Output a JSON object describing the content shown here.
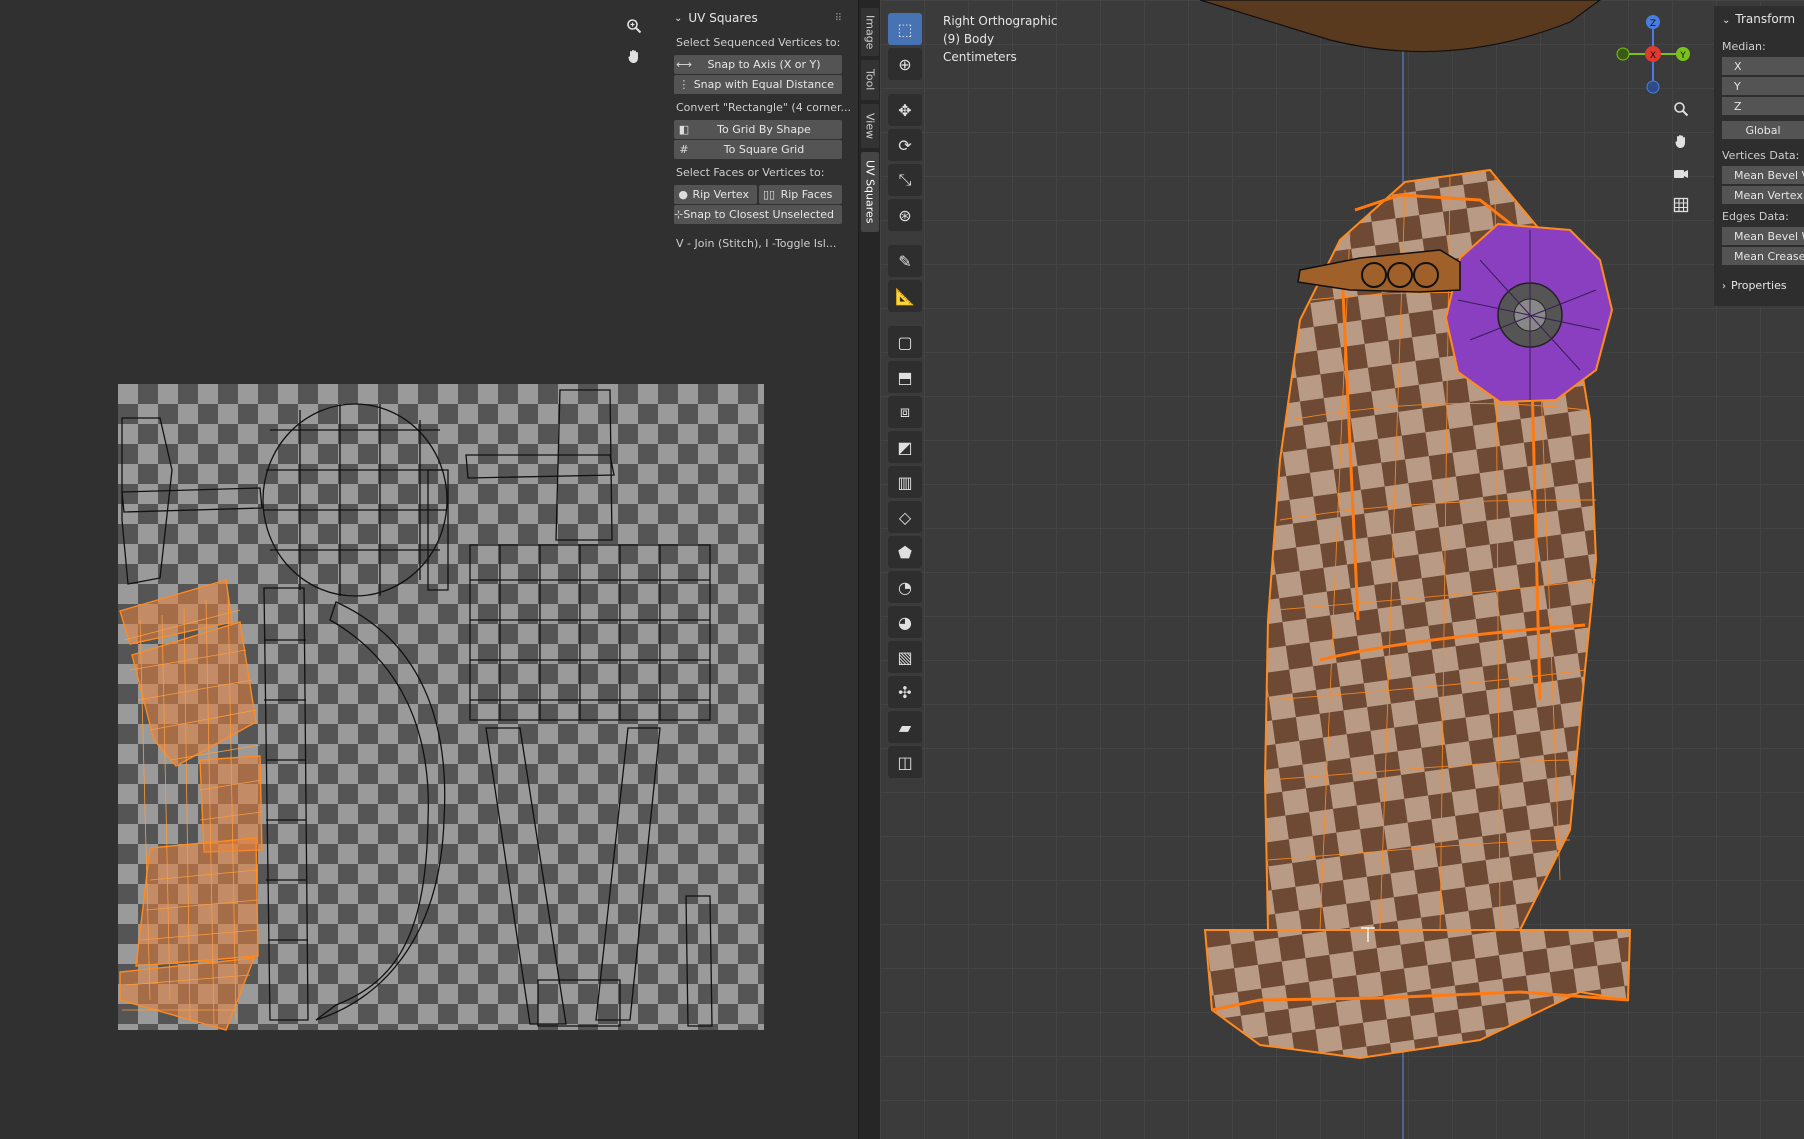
{
  "panel": {
    "title": "UV Squares",
    "section1": "Select Sequenced Vertices to:",
    "btn_snap_axis": "Snap to Axis (X or Y)",
    "btn_snap_equal": "Snap with Equal Distance",
    "section2": "Convert \"Rectangle\" (4 corner...",
    "btn_grid_shape": "To Grid By Shape",
    "btn_square_grid": "To Square Grid",
    "section3": "Select Faces or Vertices to:",
    "btn_rip_vertex": "Rip Vertex",
    "btn_rip_faces": "Rip Faces",
    "btn_snap_closest": "Snap to Closest Unselected",
    "hint": "V - Join (Stitch), I -Toggle Isl..."
  },
  "side_tabs": [
    "Image",
    "Tool",
    "View",
    "UV Squares"
  ],
  "viewport": {
    "view_name": "Right Orthographic",
    "object": "(9) Body",
    "units": "Centimeters"
  },
  "gizmo": {
    "z": "Z",
    "x": "X",
    "y": "Y"
  },
  "transform": {
    "title": "Transform",
    "median": "Median:",
    "x": "X",
    "y": "Y",
    "z": "Z",
    "global": "Global",
    "vertices_data": "Vertices Data:",
    "mean_bevel_v": "Mean Bevel V",
    "mean_vertex": "Mean Vertex",
    "edges_data": "Edges Data:",
    "mean_bevel_w": "Mean Bevel W",
    "mean_crease": "Mean Crease",
    "properties": "Properties"
  },
  "colors": {
    "accent": "#4772b3",
    "selection": "#ff8a1f",
    "eye": "#8a3fc0"
  },
  "icons": [
    "zoom-icon",
    "hand-icon",
    "camera-icon",
    "grid-icon",
    "select-box-icon",
    "cursor-icon",
    "move-icon",
    "rotate-icon",
    "scale-icon",
    "transform-icon",
    "annotate-icon",
    "measure-icon",
    "add-cube-icon",
    "extrude-icon",
    "inset-icon",
    "bevel-icon",
    "loop-cut-icon",
    "knife-icon",
    "poly-build-icon",
    "spin-icon",
    "smooth-icon",
    "edge-slide-icon",
    "shrink-icon",
    "shear-icon",
    "rip-icon"
  ]
}
